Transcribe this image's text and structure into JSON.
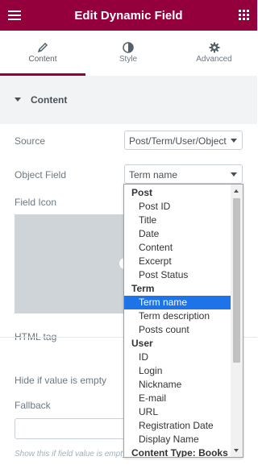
{
  "header": {
    "title": "Edit Dynamic Field"
  },
  "tabs": [
    {
      "label": "Content",
      "icon": "pencil-icon",
      "active": true
    },
    {
      "label": "Style",
      "icon": "half-circle-icon",
      "active": false
    },
    {
      "label": "Advanced",
      "icon": "gear-icon",
      "active": false
    }
  ],
  "section": {
    "title": "Content"
  },
  "fields": {
    "source_label": "Source",
    "source_value": "Post/Term/User/Object",
    "object_field_label": "Object Field",
    "object_field_value": "Term name",
    "field_icon_label": "Field Icon",
    "html_tag_label": "HTML tag",
    "hide_if_empty_label": "Hide if value is empty",
    "fallback_label": "Fallback",
    "fallback_hint": "Show this if field value is empty"
  },
  "dropdown": {
    "groups": [
      {
        "label": "Post",
        "items": [
          "Post ID",
          "Title",
          "Date",
          "Content",
          "Excerpt",
          "Post Status"
        ]
      },
      {
        "label": "Term",
        "items": [
          "Term name",
          "Term description",
          "Posts count"
        ]
      },
      {
        "label": "User",
        "items": [
          "ID",
          "Login",
          "Nickname",
          "E-mail",
          "URL",
          "Registration Date",
          "Display Name"
        ]
      },
      {
        "label": "Content Type: Books",
        "items": []
      }
    ],
    "selected": "Term name"
  },
  "colors": {
    "brand": "#93003c",
    "selection": "#1e73e8"
  }
}
